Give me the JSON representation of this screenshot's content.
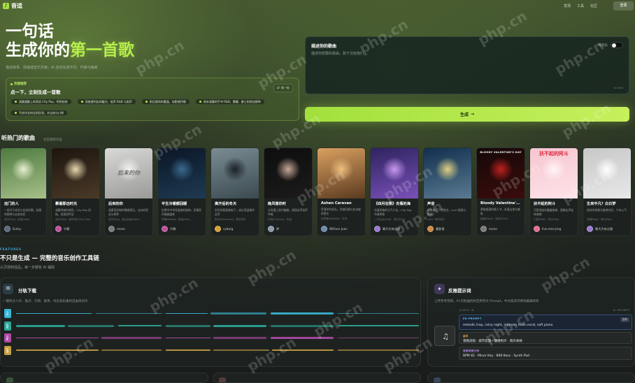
{
  "header": {
    "logo": "音适",
    "nav": [
      "发现",
      "工具",
      "社区"
    ],
    "login": "登录"
  },
  "hero": {
    "line1": "一句话",
    "line2a": "生成你的",
    "line2b": "第一首歌",
    "subtitle": "描述故事、情绪或音乐风格，AI 自动完成作词、作曲与编曲"
  },
  "inspire": {
    "tag": "灵感推荐",
    "title": "点一下，立刻生成一首歌",
    "shuffle": "换一批",
    "chips": [
      [
        "清晨通勤上的耳机 City Pop，明亮轻快",
        "深夜便利店的暖光，低声 R&B 与雨声",
        "雨后操场的重逢，电影感抒情",
        "周末清晨的手冲 R&B，慵懒、爵士和弦加钢琴"
      ],
      [
        "写给毕业的告别民谣，木吉他与口琴"
      ]
    ]
  },
  "composer": {
    "label": "描述你的歌曲",
    "instrumental": "纯音乐",
    "placeholder": "描述你想要的歌曲，剩下交给我们",
    "counter": "0/2000",
    "generate": "生成"
  },
  "songs": {
    "title": "听热门的歌曲",
    "subtitle": "社区最新作品",
    "cards": [
      {
        "title": "远门的人",
        "desc": "一首关于成长与告别的歌，轻柔的钢琴与吉他交织",
        "meta": "流行(Pop) · 民谣(Folk)",
        "user": "Gutsy",
        "cover": [
          "#4d7a3e",
          "#a8bf8a",
          "#e8f0d0"
        ],
        "avatar": "#5a6a7a"
      },
      {
        "title": "裹着那远时光",
        "desc": "温暖的城市夜色，City Pop 风格，轻快而怀旧",
        "meta": "流行(Pop) · 城市流行(City Pop)",
        "user": "宁静",
        "cover": [
          "#1e150e",
          "#4a3a28",
          "#e8d8b0"
        ],
        "avatar": "#c050a0"
      },
      {
        "title": "后来的你",
        "desc": "温柔而克制的情感表达，淡淡的思念与释怀",
        "meta": "流行(Pop) · 独立民谣(Indie)",
        "user": "mono",
        "cover": [
          "#d8d8d6",
          "#9a9a98",
          "#f2f2f2"
        ],
        "cover_text": "后来的你",
        "avatar": "#7a7a7a"
      },
      {
        "title": "平生冷暖都回暖",
        "desc": "在寒冷中寻找温度的旋律，深情男声娓娓道来",
        "meta": "抒情(Ballad) · 民谣(Folk)",
        "user": "宁静",
        "cover": [
          "#0b1626",
          "#1e3a52",
          "#3a6a90"
        ],
        "avatar": "#c050a0"
      },
      {
        "title": "离开后的冬天",
        "desc": "空灵的氛围感电子，迷幻而温柔的女声",
        "meta": "电子(Electronic) · 梦幻流行",
        "user": "cyborg",
        "cover": [
          "#7a8c92",
          "#3a4a50",
          "#1a2226"
        ],
        "avatar": "#d8a030"
      },
      {
        "title": "晚风落你时",
        "desc": "古风遇上现代编曲，清丽女声轻声吟唱",
        "meta": "古风(Chinese) · 民谣",
        "user": "梦",
        "cover": [
          "#0e0e0e",
          "#1c1a1a",
          "#c8a898"
        ],
        "avatar": "#8a9aa8"
      },
      {
        "title": "Ashen Caravan",
        "desc": "荒漠中的驼队，异域风情与史诗般的弦乐",
        "meta": "世界音乐(World) · 史诗",
        "user": "Willium Joan",
        "cover": [
          "#d9a060",
          "#5a3a20",
          "#f0c080"
        ],
        "avatar": "#6a8ab0"
      },
      {
        "title": "《四月狂想》去看的海",
        "desc": "动漫风格的元气少女，City Pop 节奏明快",
        "meta": "二次元(Anime) · 流行(Pop)",
        "user": "篱大大有点甜",
        "cover": [
          "#2e2460",
          "#7a50b8",
          "#c89af0"
        ],
        "avatar": "#9a7ad0"
      },
      {
        "title": "声音",
        "desc": "雨夜路灯下的独白，Lo-fi 氛围与钢琴",
        "meta": "Lo-fi · 城市流行",
        "user": "暮影青",
        "cover": [
          "#12304e",
          "#5a7a92",
          "#e0d080"
        ],
        "avatar": "#d08a40"
      },
      {
        "title": "Bloody Valentine's Day",
        "desc": "黑暗摇滚的情人节，失真吉他与嘶吼",
        "meta": "摇滚(Rock) · 朋克(Punk)",
        "user": "mono",
        "cover": [
          "#160808",
          "#3a0c0c",
          "#c02020"
        ],
        "cover_text": "BLOODY VALENTINE'S DAY",
        "avatar": "#7a7a7a"
      },
      {
        "title": "扶不起的阿斗",
        "desc": "可爱俏皮的童趣旋律，甜美女声轻快演唱",
        "meta": "儿童(Kids) · 流行(Pop)",
        "user": "live-ems-jmg",
        "cover": [
          "#f5c6d0",
          "#ffe2e8",
          "#fff4f6"
        ],
        "cover_text": "扶不起的阿斗",
        "avatar": "#e07090"
      },
      {
        "title": "生来平凡？白日梦",
        "desc": "轻快的说唱与旋律交织，少年心气",
        "meta": "说唱(Rap) · 流行(Pop)",
        "user": "篱大大有点甜",
        "cover": [
          "#c8c8c8",
          "#e8e8e8",
          "#ffffff"
        ],
        "avatar": "#9a7ad0"
      }
    ]
  },
  "features": {
    "label": "FEATURES",
    "title": "不只是生成 — 完整的音乐创作工具链",
    "subtitle": "从灵感到成品，每一步都有 AI 辅助",
    "split": {
      "title": "分轨下载",
      "subtitle": "一键拆分人声、鼓点、贝斯、旋律，导出多轨素材自由再创作",
      "tracks": [
        {
          "label": "人声",
          "color": "#3ab6d6"
        },
        {
          "label": "鼓组",
          "color": "#2aa898"
        },
        {
          "label": "贝斯",
          "color": "#b04aa8"
        },
        {
          "label": "旋律",
          "color": "#c8a040"
        }
      ]
    },
    "prompt": {
      "title": "反推提示词",
      "subtitle": "上传参考音频，AI 识别曲风并还原英文 Prompt，中文描述可继续编辑修改",
      "audio_in": "AUDIO IN",
      "ai_prompt": "AI PROMPT",
      "en_label": "EN PROMPT",
      "en_text": "melodic trap, rainy night, intimate male vocal, soft piano",
      "copy": "复制",
      "style_label": "曲风",
      "style_text": "夜晚说唱 · 城市氛围 · 慵懒男声 · 雨声采样",
      "params_label": "音频参数分析",
      "params_text": "BPM 82 · Minor Key · 808 Bass · Synth Pad"
    }
  },
  "colors": {
    "accent": "#b5ec4c",
    "bg": "#1f2420",
    "card": "#1d2220",
    "info": "#4aa8d8"
  },
  "watermark": "php.cn"
}
